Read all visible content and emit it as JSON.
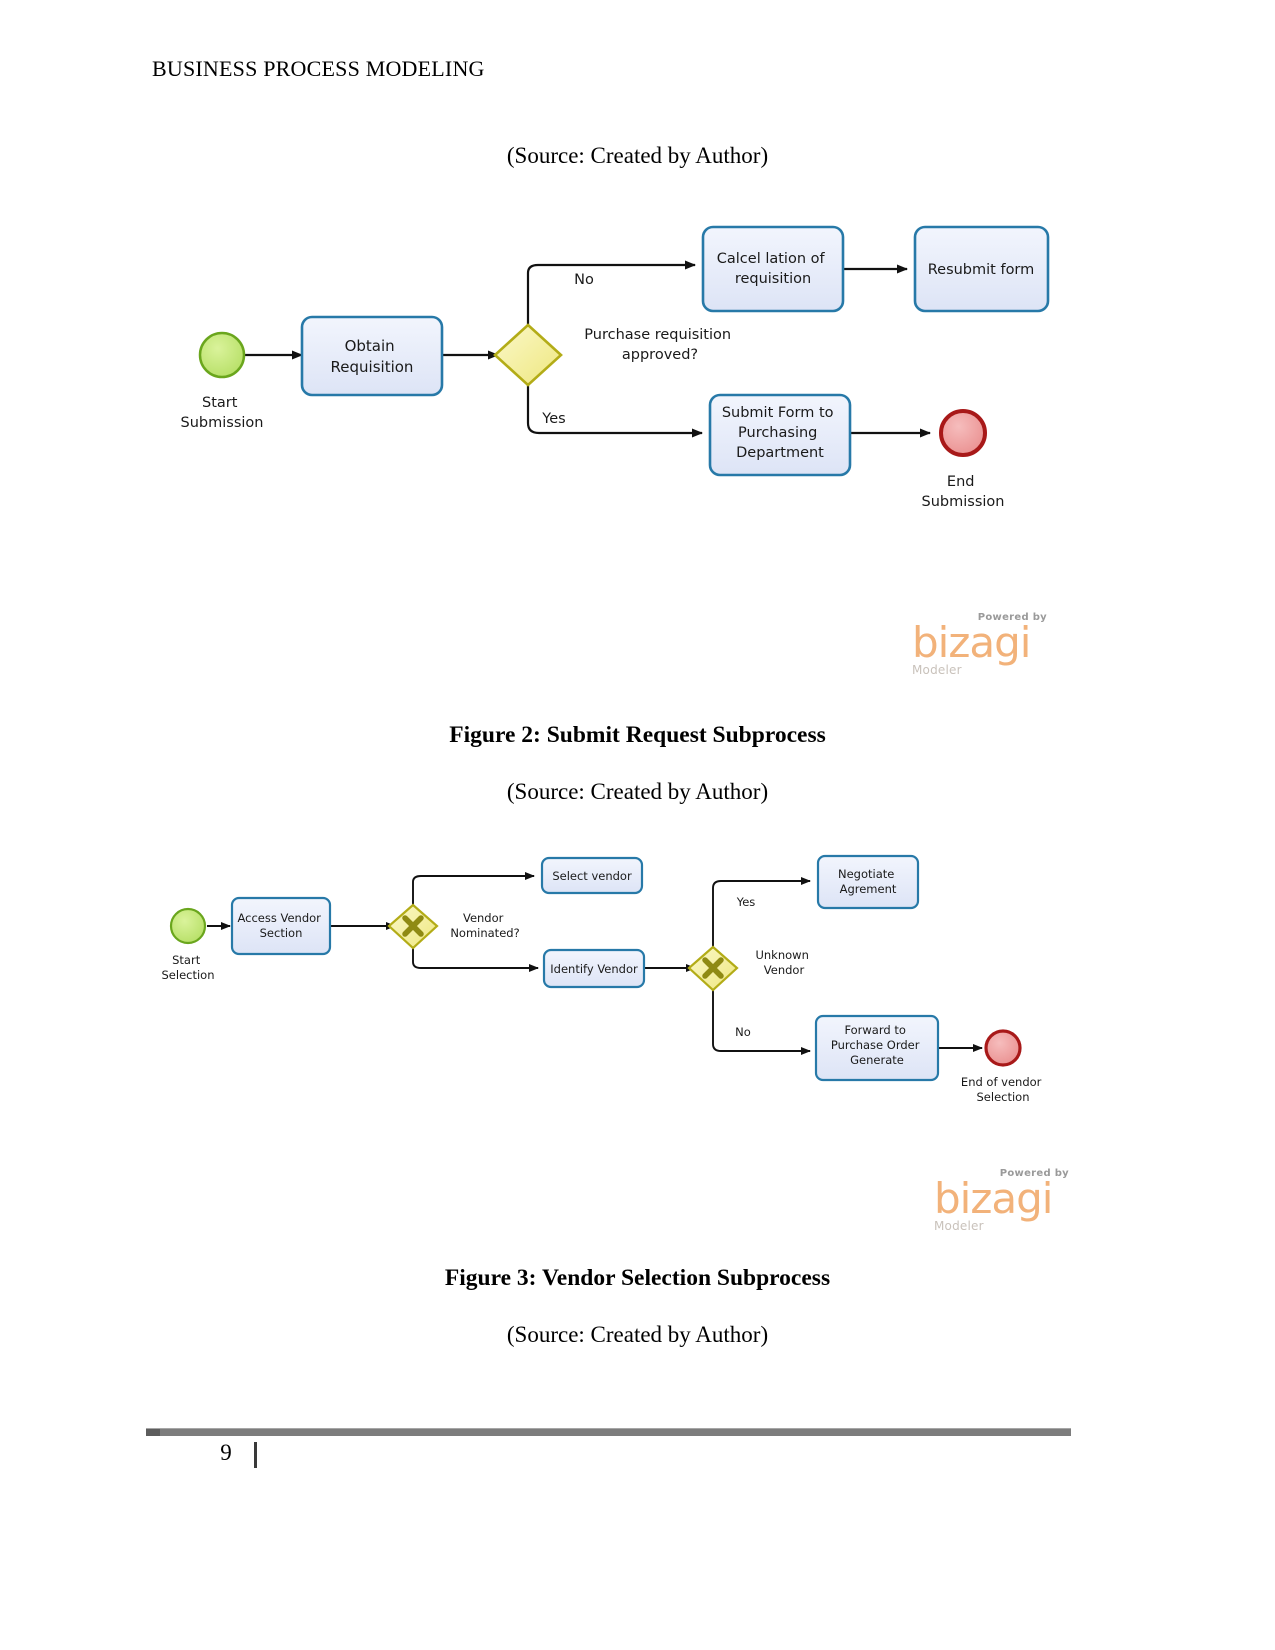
{
  "document": {
    "running_head": "BUSINESS PROCESS MODELING",
    "page_number": "9",
    "source_note_1": "(Source: Created by Author)",
    "figure2_caption": "Figure 2: Submit Request Subprocess",
    "source_note_2": "(Source: Created by Author)",
    "figure3_caption": "Figure 3: Vendor Selection Subprocess",
    "source_note_3": "(Source: Created by Author)"
  },
  "watermark": {
    "powered_by": "Powered by",
    "wordmark": "bizagi",
    "product": "Modeler"
  },
  "colors": {
    "task_fill": "#e8ecf8",
    "task_stroke": "#2779a8",
    "gateway_fill": "#f5f09a",
    "gateway_stroke": "#b3ac17",
    "start_fill": "#c3e77e",
    "start_stroke": "#6aa61d",
    "end_fill": "#ef9a9a",
    "end_stroke": "#a81919",
    "connector": "#1a1a1a",
    "accent_orange": "#f2b27a",
    "footer_rule": "#7d7d7d"
  },
  "figure2": {
    "title": "Submit Request Subprocess",
    "nodes": [
      {
        "id": "start",
        "type": "start-event",
        "label": "Start\nSubmission",
        "label_position": "below"
      },
      {
        "id": "obtain",
        "type": "task",
        "label": "Obtain\nRequisition"
      },
      {
        "id": "gateway",
        "type": "exclusive-gateway",
        "label": "Purchase requisition\napproved?",
        "label_position": "right"
      },
      {
        "id": "cancel",
        "type": "task",
        "label": "Calcel lation of\nrequisition"
      },
      {
        "id": "resubmit",
        "type": "task",
        "label": "Resubmit form"
      },
      {
        "id": "submit",
        "type": "task",
        "label": "Submit Form to\nPurchasing\nDepartment"
      },
      {
        "id": "end",
        "type": "end-event",
        "label": "End\nSubmission",
        "label_position": "below"
      }
    ],
    "flows": [
      {
        "from": "start",
        "to": "obtain",
        "label": ""
      },
      {
        "from": "obtain",
        "to": "gateway",
        "label": ""
      },
      {
        "from": "gateway",
        "to": "cancel",
        "label": "No"
      },
      {
        "from": "cancel",
        "to": "resubmit",
        "label": ""
      },
      {
        "from": "gateway",
        "to": "submit",
        "label": "Yes"
      },
      {
        "from": "submit",
        "to": "end",
        "label": ""
      }
    ]
  },
  "figure3": {
    "title": "Vendor Selection Subprocess",
    "nodes": [
      {
        "id": "start",
        "type": "start-event",
        "label": "Start\nSelection",
        "label_position": "below"
      },
      {
        "id": "access",
        "type": "task",
        "label": "Access Vendor\nSection"
      },
      {
        "id": "gw1",
        "type": "exclusive-gateway",
        "label": "Vendor\nNominated?",
        "label_position": "right"
      },
      {
        "id": "select",
        "type": "task",
        "label": "Select vendor"
      },
      {
        "id": "identify",
        "type": "task",
        "label": "Identify Vendor"
      },
      {
        "id": "gw2",
        "type": "exclusive-gateway",
        "label": "Unknown\nVendor",
        "label_position": "right"
      },
      {
        "id": "negotiate",
        "type": "task",
        "label": "Negotiate\nAgrement"
      },
      {
        "id": "forward",
        "type": "task",
        "label": "Forward to\nPurchase Order\nGenerate"
      },
      {
        "id": "end",
        "type": "end-event",
        "label": "End of vendor\nSelection",
        "label_position": "below"
      }
    ],
    "flows": [
      {
        "from": "start",
        "to": "access",
        "label": ""
      },
      {
        "from": "access",
        "to": "gw1",
        "label": ""
      },
      {
        "from": "gw1",
        "to": "select",
        "label": ""
      },
      {
        "from": "gw1",
        "to": "identify",
        "label": ""
      },
      {
        "from": "identify",
        "to": "gw2",
        "label": ""
      },
      {
        "from": "gw2",
        "to": "negotiate",
        "label": "Yes"
      },
      {
        "from": "gw2",
        "to": "forward",
        "label": "No"
      },
      {
        "from": "forward",
        "to": "end",
        "label": ""
      }
    ]
  }
}
